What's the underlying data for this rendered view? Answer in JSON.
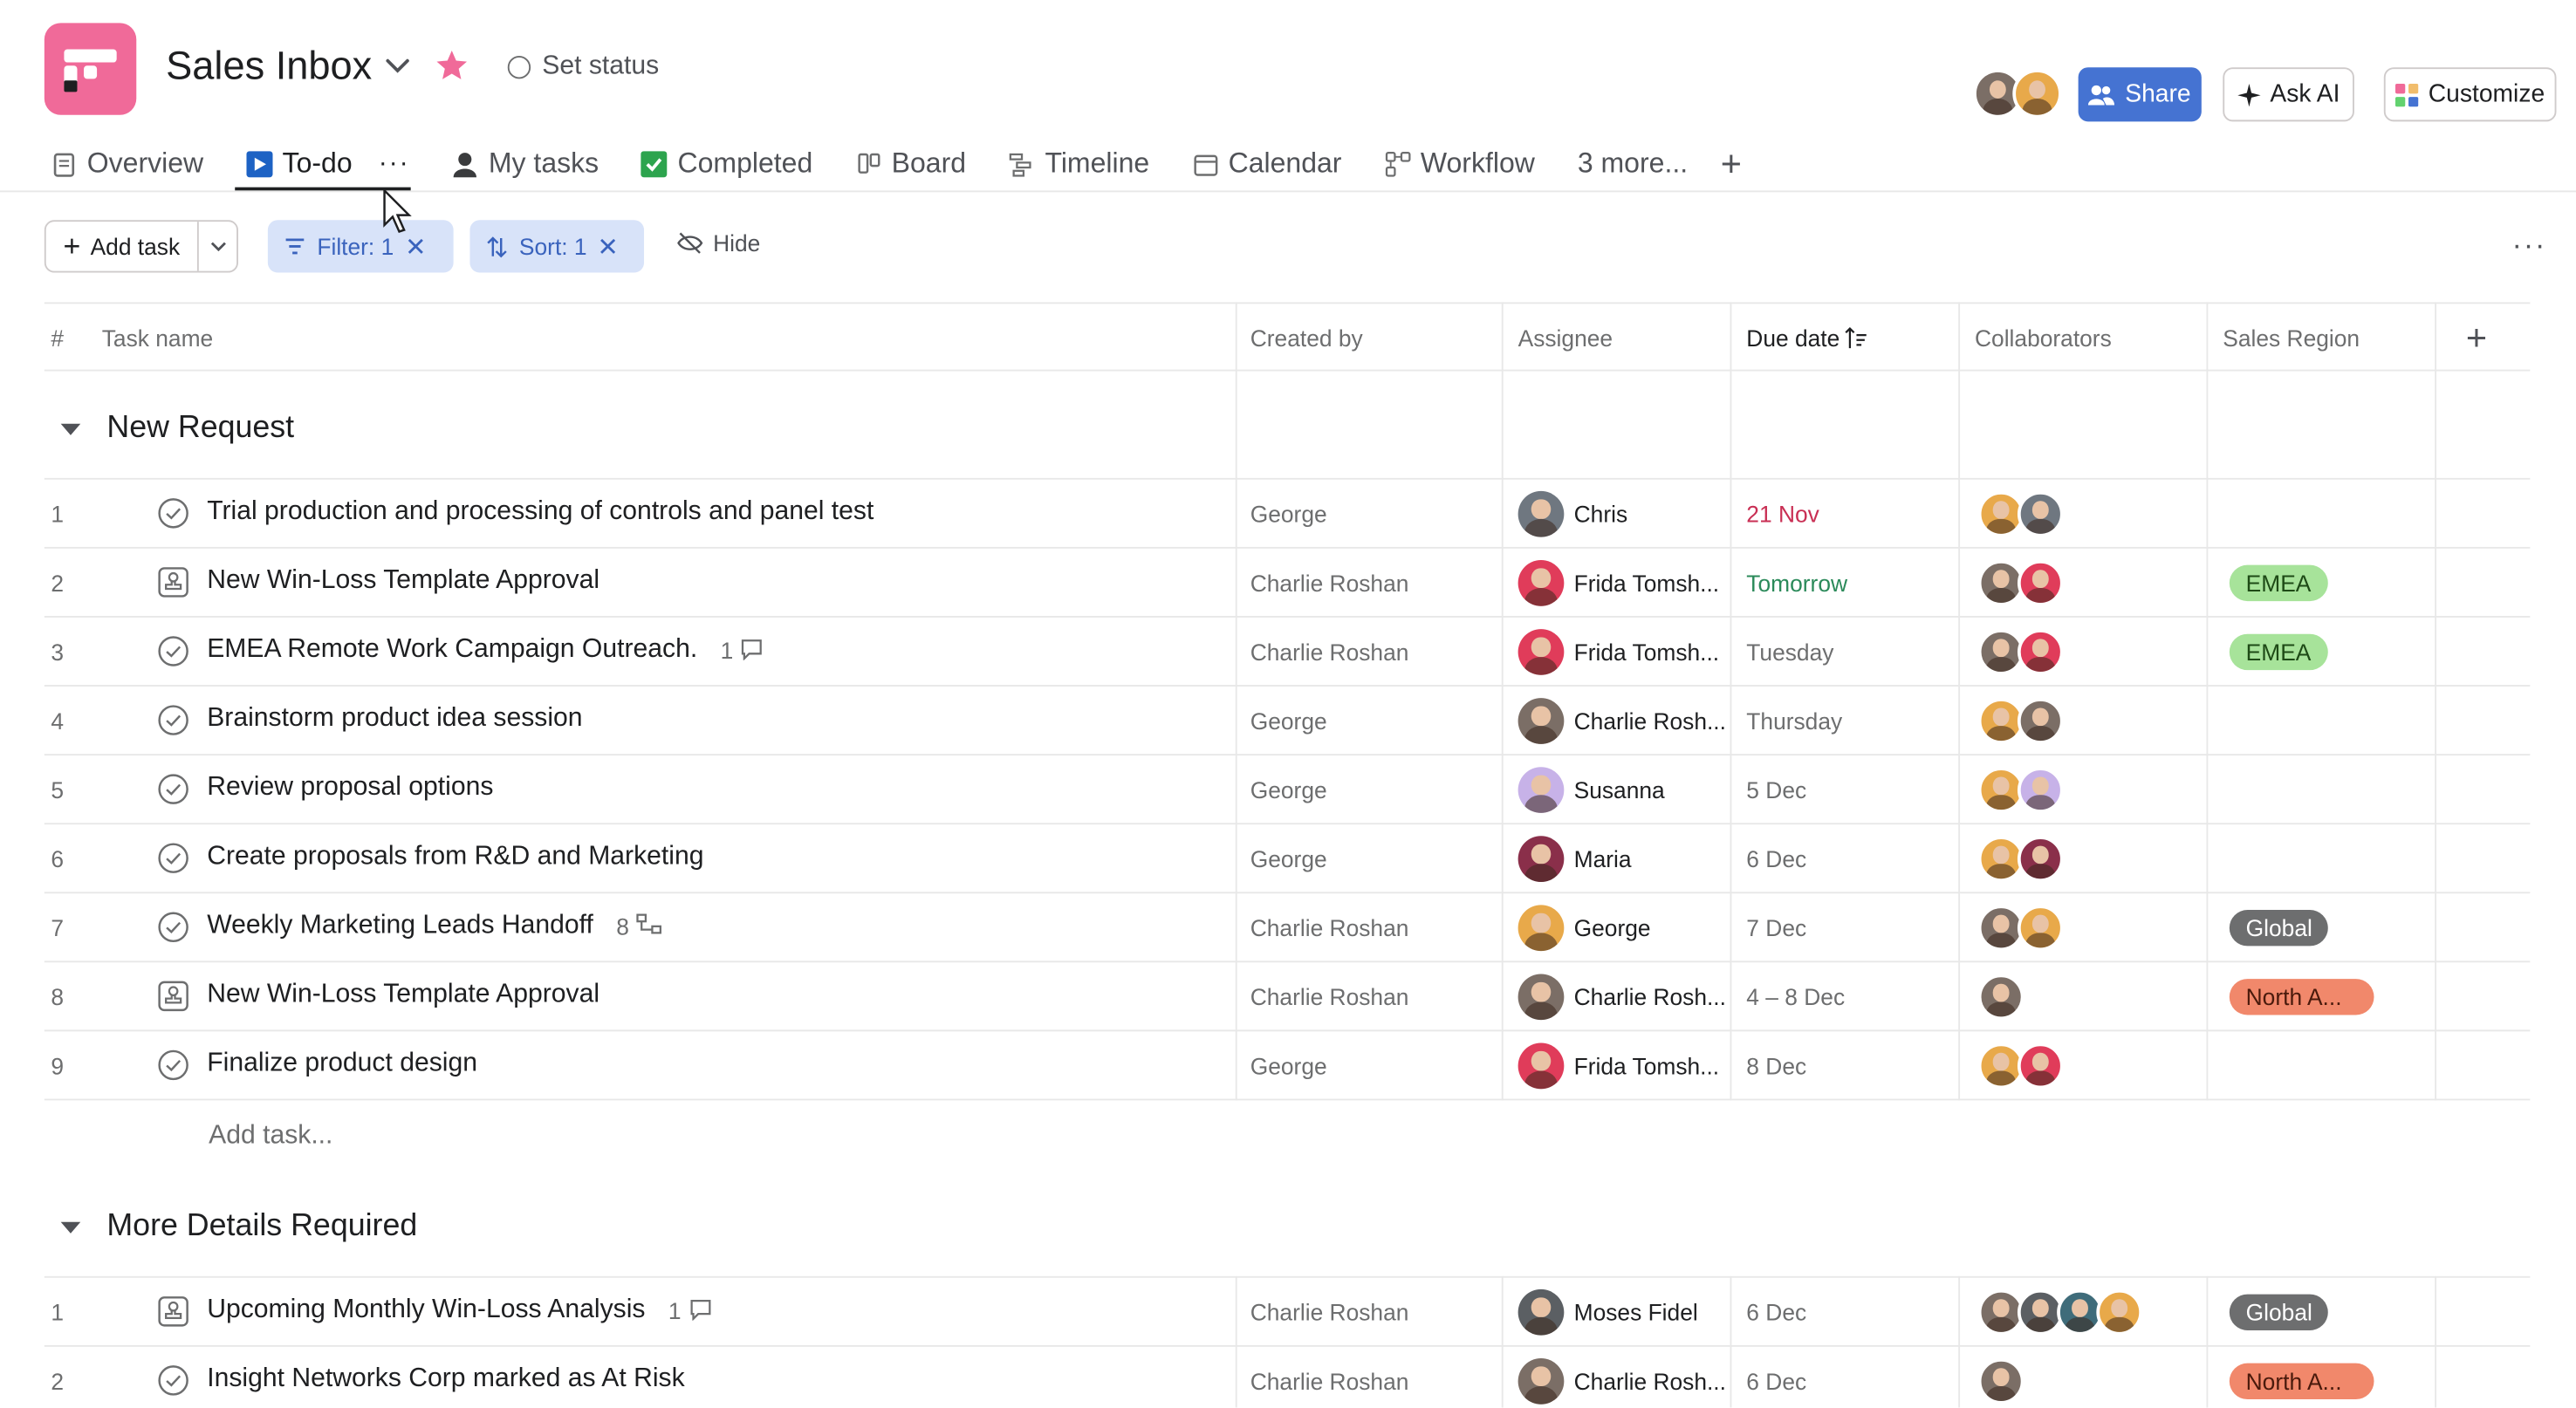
{
  "header": {
    "project_title": "Sales Inbox",
    "set_status": "Set status",
    "share_label": "Share",
    "ask_ai_label": "Ask AI",
    "customize_label": "Customize",
    "accent": "#f06a99",
    "share_color": "#4573d2"
  },
  "tabs": [
    {
      "label": "Overview",
      "icon": "overview-icon"
    },
    {
      "label": "To-do",
      "icon": "todo-icon",
      "active": true
    },
    {
      "label": "My tasks",
      "icon": "person-icon"
    },
    {
      "label": "Completed",
      "icon": "check-box-icon"
    },
    {
      "label": "Board",
      "icon": "board-icon"
    },
    {
      "label": "Timeline",
      "icon": "timeline-icon"
    },
    {
      "label": "Calendar",
      "icon": "calendar-icon"
    },
    {
      "label": "Workflow",
      "icon": "workflow-icon"
    },
    {
      "label": "3 more..."
    }
  ],
  "toolbar": {
    "add_task_label": "Add task",
    "filter_label": "Filter: 1",
    "sort_label": "Sort: 1",
    "hide_label": "Hide"
  },
  "columns": {
    "num": "#",
    "task_name": "Task name",
    "created_by": "Created by",
    "assignee": "Assignee",
    "due_date": "Due date",
    "collaborators": "Collaborators",
    "sales_region": "Sales Region"
  },
  "sections": [
    {
      "title": "New Request",
      "add_task_placeholder": "Add task...",
      "rows": [
        {
          "num": "1",
          "icon": "check-circle-icon",
          "name": "Trial production and processing of controls and panel test",
          "created_by": "George",
          "assignee": "Chris",
          "assignee_avatar": "a-chris",
          "due": "21 Nov",
          "due_style": "red",
          "collaborators": [
            "a-george",
            "a-chris"
          ],
          "region": ""
        },
        {
          "num": "2",
          "icon": "approval-icon",
          "name": "New Win-Loss Template Approval",
          "created_by": "Charlie Roshan",
          "assignee": "Frida Tomsh...",
          "assignee_avatar": "a-frida",
          "due": "Tomorrow",
          "due_style": "green",
          "collaborators": [
            "a-charlie",
            "a-frida"
          ],
          "region": "EMEA",
          "region_bg": "#a7e39a",
          "region_fg": "#1e4a16"
        },
        {
          "num": "3",
          "icon": "check-circle-icon",
          "name": "EMEA Remote Work Campaign Outreach.",
          "meta": "1",
          "meta_icon": "comment-icon",
          "created_by": "Charlie Roshan",
          "assignee": "Frida Tomsh...",
          "assignee_avatar": "a-frida",
          "due": "Tuesday",
          "due_style": "",
          "collaborators": [
            "a-charlie",
            "a-frida"
          ],
          "region": "EMEA",
          "region_bg": "#a7e39a",
          "region_fg": "#1e4a16"
        },
        {
          "num": "4",
          "icon": "check-circle-icon",
          "name": "Brainstorm product idea session",
          "created_by": "George",
          "assignee": "Charlie Rosh...",
          "assignee_avatar": "a-charlie",
          "due": "Thursday",
          "due_style": "",
          "collaborators": [
            "a-george",
            "a-charlie"
          ],
          "region": ""
        },
        {
          "num": "5",
          "icon": "check-circle-icon",
          "name": "Review proposal options",
          "created_by": "George",
          "assignee": "Susanna",
          "assignee_avatar": "a-susanna",
          "due": "5 Dec",
          "due_style": "",
          "collaborators": [
            "a-george",
            "a-susanna"
          ],
          "region": ""
        },
        {
          "num": "6",
          "icon": "check-circle-icon",
          "name": "Create proposals from R&D and Marketing",
          "created_by": "George",
          "assignee": "Maria",
          "assignee_avatar": "a-maria",
          "due": "6 Dec",
          "due_style": "",
          "collaborators": [
            "a-george",
            "a-maria"
          ],
          "region": ""
        },
        {
          "num": "7",
          "icon": "check-circle-icon",
          "name": "Weekly Marketing Leads Handoff",
          "meta": "8",
          "meta_icon": "subtask-icon",
          "created_by": "Charlie Roshan",
          "assignee": "George",
          "assignee_avatar": "a-george",
          "due": "7 Dec",
          "due_style": "",
          "collaborators": [
            "a-charlie",
            "a-george"
          ],
          "region": "Global",
          "region_bg": "#6d6e6f",
          "region_fg": "#ffffff"
        },
        {
          "num": "8",
          "icon": "approval-icon",
          "name": "New Win-Loss Template Approval",
          "created_by": "Charlie Roshan",
          "assignee": "Charlie Rosh...",
          "assignee_avatar": "a-charlie",
          "due": "4 – 8 Dec",
          "due_style": "",
          "collaborators": [
            "a-charlie"
          ],
          "region": "North A...",
          "region_bg": "#f1886b",
          "region_fg": "#4a1a0c"
        },
        {
          "num": "9",
          "icon": "check-circle-icon",
          "name": "Finalize product design",
          "created_by": "George",
          "assignee": "Frida Tomsh...",
          "assignee_avatar": "a-frida",
          "due": "8 Dec",
          "due_style": "",
          "collaborators": [
            "a-george",
            "a-frida"
          ],
          "region": ""
        }
      ]
    },
    {
      "title": "More Details Required",
      "rows": [
        {
          "num": "1",
          "icon": "approval-icon",
          "name": "Upcoming Monthly Win-Loss Analysis",
          "meta": "1",
          "meta_icon": "comment-icon",
          "created_by": "Charlie Roshan",
          "assignee": "Moses Fidel",
          "assignee_avatar": "a-moses",
          "due": "6 Dec",
          "due_style": "",
          "collaborators": [
            "a-charlie",
            "a-moses",
            "a-other",
            "a-george"
          ],
          "region": "Global",
          "region_bg": "#6d6e6f",
          "region_fg": "#ffffff"
        },
        {
          "num": "2",
          "icon": "check-circle-icon",
          "name": "Insight Networks Corp marked as At Risk",
          "created_by": "Charlie Roshan",
          "assignee": "Charlie Rosh...",
          "assignee_avatar": "a-charlie",
          "due": "6 Dec",
          "due_style": "",
          "collaborators": [
            "a-charlie"
          ],
          "region": "North A...",
          "region_bg": "#f1886b",
          "region_fg": "#4a1a0c"
        }
      ]
    }
  ]
}
